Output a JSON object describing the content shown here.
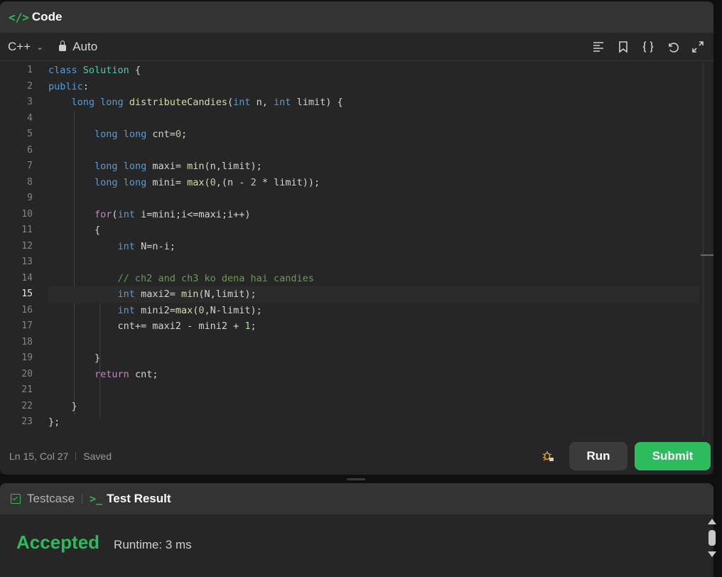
{
  "panel": {
    "title": "Code"
  },
  "toolbar": {
    "language": "C++",
    "mode": "Auto"
  },
  "editor": {
    "line_numbers": [
      "1",
      "2",
      "3",
      "4",
      "5",
      "6",
      "7",
      "8",
      "9",
      "10",
      "11",
      "12",
      "13",
      "14",
      "15",
      "16",
      "17",
      "18",
      "19",
      "20",
      "21",
      "22",
      "23"
    ],
    "active_line": "15",
    "code": [
      "class Solution {",
      "public:",
      "    long long distributeCandies(int n, int limit) {",
      "",
      "        long long cnt=0;",
      "",
      "        long long maxi= min(n,limit);",
      "        long long mini= max(0,(n - 2 * limit));",
      "",
      "        for(int i=mini;i<=maxi;i++)",
      "        {",
      "            int N=n-i;",
      "",
      "            // ch2 and ch3 ko dena hai candies",
      "            int maxi2= min(N,limit);",
      "            int mini2=max(0,N-limit);",
      "            cnt+= maxi2 - mini2 + 1;",
      "",
      "        }",
      "        return cnt;",
      "",
      "    }",
      "};"
    ]
  },
  "status": {
    "position": "Ln 15, Col 27",
    "saved": "Saved"
  },
  "actions": {
    "run": "Run",
    "submit": "Submit"
  },
  "result": {
    "tabs": {
      "testcase": "Testcase",
      "test_result": "Test Result"
    },
    "verdict": "Accepted",
    "runtime": "Runtime: 3 ms"
  },
  "colors": {
    "accent": "#2cbb5d",
    "background": "#262626",
    "header": "#333333"
  }
}
